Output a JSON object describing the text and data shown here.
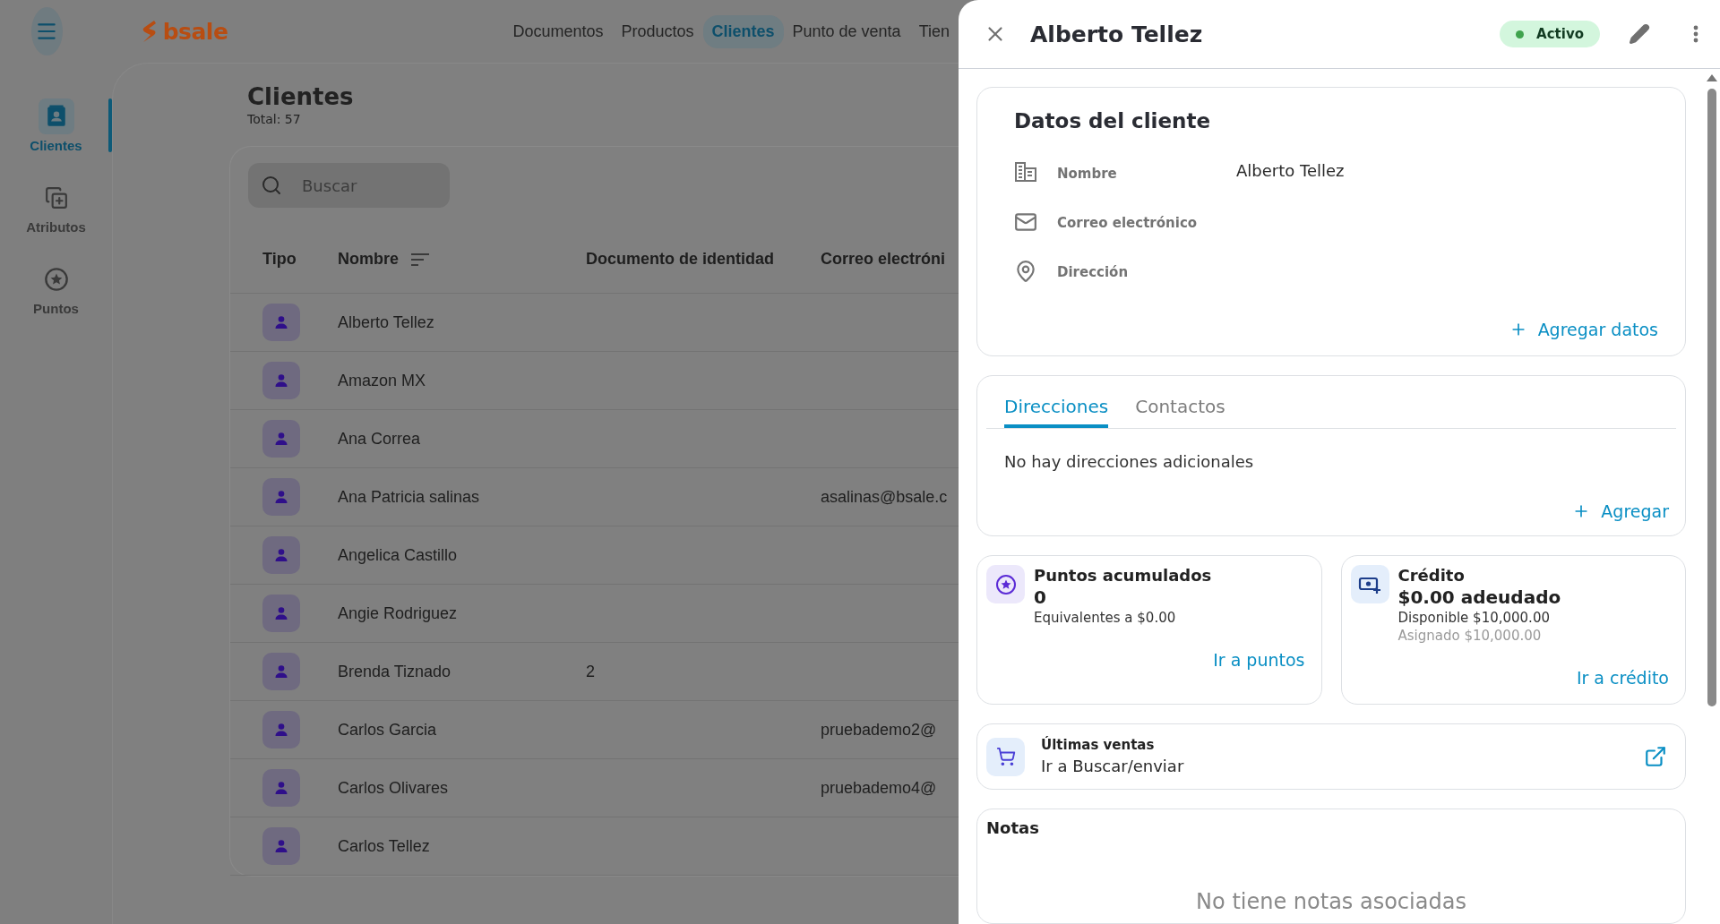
{
  "topbar": {
    "logo": "bsale",
    "nav": [
      {
        "label": "Documentos",
        "selected": false
      },
      {
        "label": "Productos",
        "selected": false
      },
      {
        "label": "Clientes",
        "selected": true
      },
      {
        "label": "Punto de venta",
        "selected": false
      },
      {
        "label": "Tien",
        "selected": false
      }
    ]
  },
  "sidebar": {
    "items": [
      {
        "kind": "clients",
        "label": "Clientes",
        "selected": true
      },
      {
        "kind": "attributes",
        "label": "Atributos",
        "selected": false
      },
      {
        "kind": "points",
        "label": "Puntos",
        "selected": false
      }
    ]
  },
  "page": {
    "title": "Clientes",
    "total": "Total: 57",
    "search": {
      "placeholder": "Buscar"
    },
    "columns": [
      "Tipo",
      "Nombre",
      "Documento de identidad",
      "Correo electróni"
    ],
    "rows": [
      {
        "name": "Alberto Tellez"
      },
      {
        "name": "Amazon MX"
      },
      {
        "name": "Ana Correa"
      },
      {
        "name": "Ana Patricia salinas",
        "email": "asalinas@bsale.c"
      },
      {
        "name": "Angelica Castillo"
      },
      {
        "name": "Angie Rodriguez"
      },
      {
        "name": "Brenda Tiznado",
        "document": "2"
      },
      {
        "name": "Carlos Garcia",
        "email": "pruebademo2@"
      },
      {
        "name": "Carlos Olivares",
        "email": "pruebademo4@"
      },
      {
        "name": "Carlos Tellez"
      }
    ]
  },
  "drawer": {
    "title": "Alberto Tellez",
    "status": {
      "label": "Activo",
      "active": true
    },
    "details": {
      "title": "Datos del cliente",
      "fields": [
        {
          "kind": "name",
          "label": "Nombre",
          "value": "Alberto Tellez"
        },
        {
          "kind": "email",
          "label": "Correo electrónico"
        },
        {
          "kind": "address",
          "label": "Dirección"
        }
      ],
      "add_link": "Agregar datos"
    },
    "tabs": [
      {
        "label": "Direcciones",
        "selected": true
      },
      {
        "label": "Contactos",
        "selected": false
      }
    ],
    "tab_empty": "No hay direcciones adicionales",
    "tab_add": "Agregar",
    "points": {
      "title": "Puntos acumulados",
      "value": "0",
      "equivalent": "Equivalentes a $0.00",
      "link": "Ir a puntos"
    },
    "credit": {
      "title": "Crédito",
      "owed": "$0.00 adeudado",
      "available": "Disponible $10,000.00",
      "assigned": "Asignado $10,000.00",
      "link": "Ir a crédito"
    },
    "sales": {
      "title": "Últimas ventas",
      "link": "Ir a Buscar/enviar"
    },
    "notes": {
      "title": "Notas",
      "empty": "No tiene notas asociadas"
    }
  }
}
